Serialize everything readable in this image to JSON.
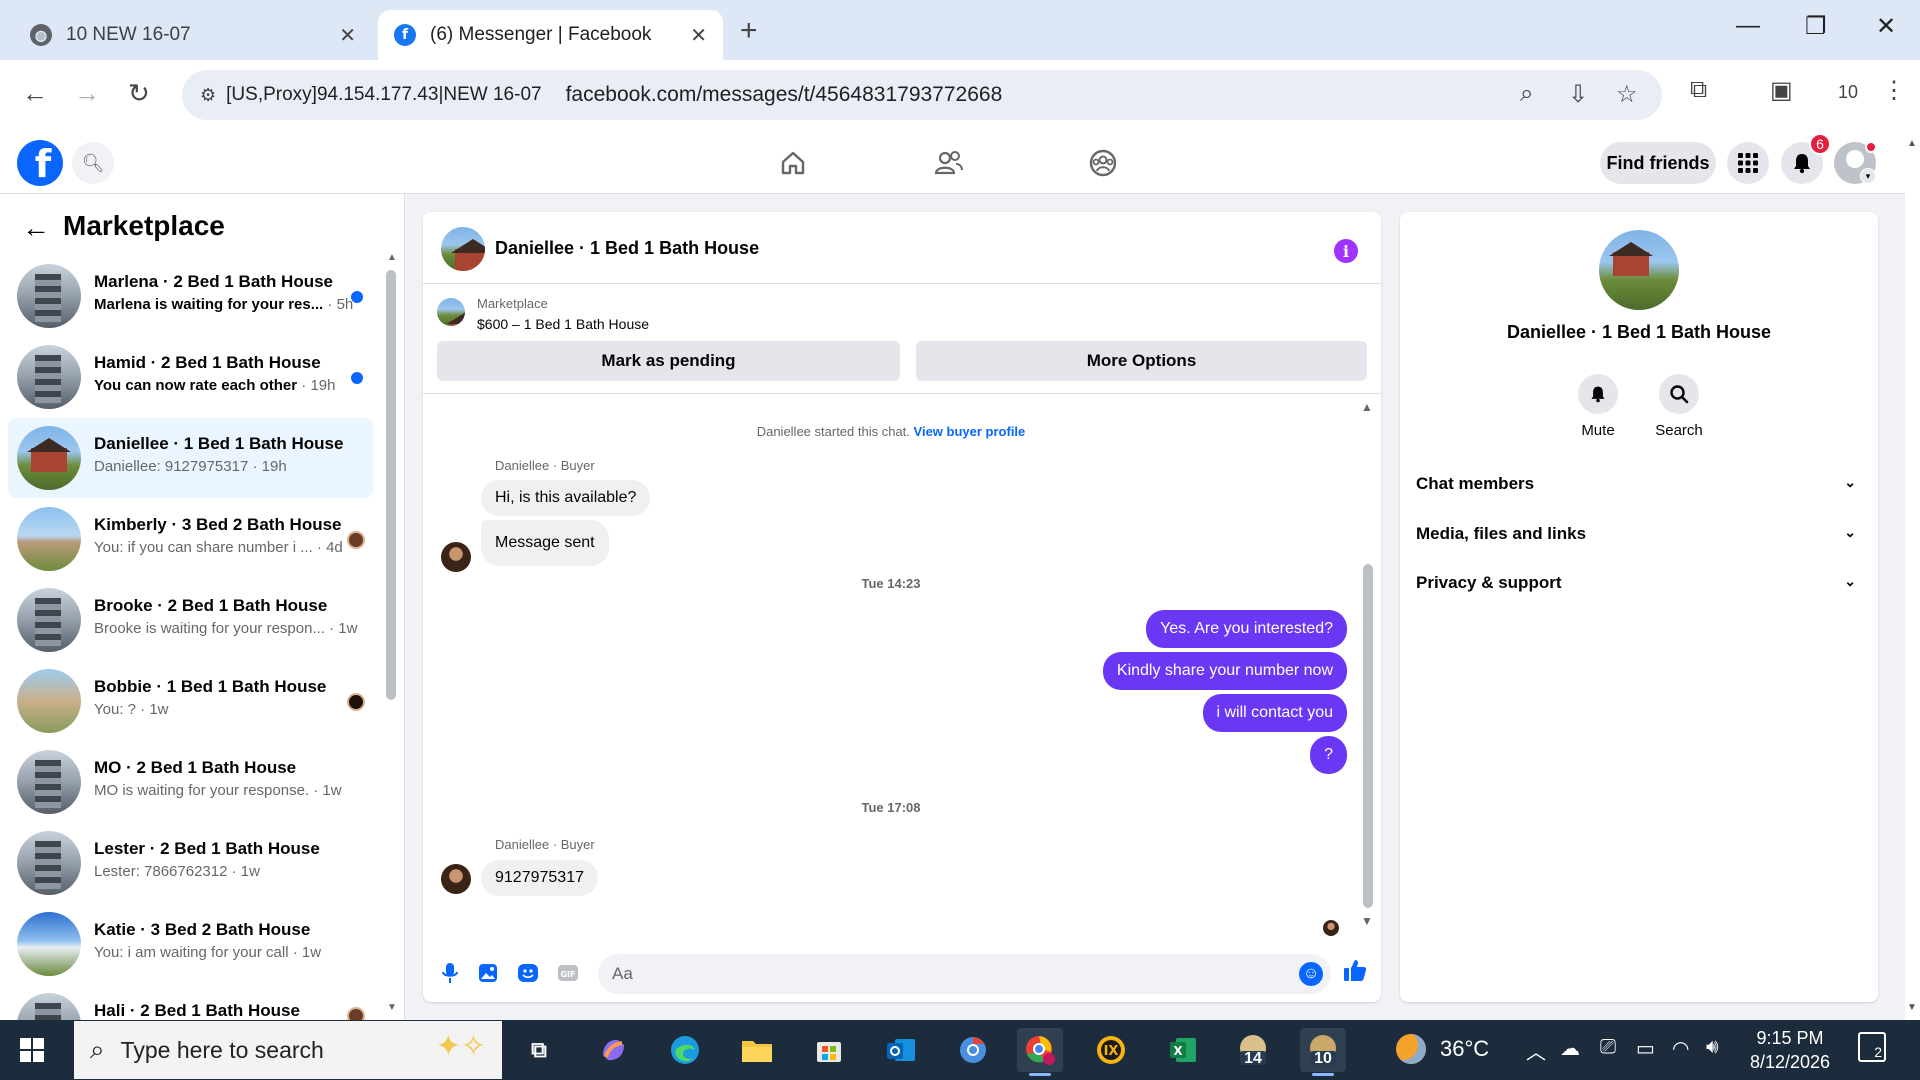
{
  "browser": {
    "tabs": [
      {
        "title": "10 NEW 16-07",
        "icon": "globe-icon",
        "active": false
      },
      {
        "title": "(6) Messenger | Facebook",
        "icon": "facebook-icon",
        "active": true
      }
    ],
    "proxy_chip": "[US,Proxy]94.154.177.43|NEW 16-07",
    "url": "facebook.com/messages/t/4564831793772668",
    "profile_count": "10"
  },
  "fb_header": {
    "find_friends_label": "Find friends",
    "notification_count": "6"
  },
  "left": {
    "back_icon": "arrow-left-icon",
    "title": "Marketplace",
    "conversations": [
      {
        "name": "Marlena · 2 Bed 1 Bath House",
        "preview": "Marlena is waiting for your res...",
        "time": "· 5h",
        "unread": true,
        "avatar": "apartment"
      },
      {
        "name": "Hamid · 2 Bed 1 Bath House",
        "preview": "You can now rate each other",
        "time": "· 19h",
        "unread": true,
        "avatar": "apartment"
      },
      {
        "name": "Daniellee · 1 Bed 1 Bath House",
        "preview": "Daniellee: 9127975317",
        "time": "· 19h",
        "unread": false,
        "active": true,
        "avatar": "house"
      },
      {
        "name": "Kimberly · 3 Bed 2 Bath House",
        "preview": "You: if you can share number i ...",
        "time": "· 4d",
        "unread": false,
        "avatar": "ranch"
      },
      {
        "name": "Brooke · 2 Bed 1 Bath House",
        "preview": "Brooke is waiting for your respon...",
        "time": "· 1w",
        "unread": false,
        "avatar": "apartment"
      },
      {
        "name": "Bobbie · 1 Bed 1 Bath House",
        "preview": "You: ?",
        "time": "· 1w",
        "unread": false,
        "avatar": "tan"
      },
      {
        "name": "MO · 2 Bed 1 Bath House",
        "preview": "MO is waiting for your response.",
        "time": "· 1w",
        "unread": false,
        "avatar": "apartment"
      },
      {
        "name": "Lester · 2 Bed 1 Bath House",
        "preview": "Lester: 7866762312",
        "time": "· 1w",
        "unread": false,
        "avatar": "apartment"
      },
      {
        "name": "Katie · 3 Bed 2 Bath House",
        "preview": "You: i am waiting for your call",
        "time": "· 1w",
        "unread": false,
        "avatar": "mobile"
      },
      {
        "name": "Hali · 2 Bed 1 Bath House",
        "preview": "",
        "time": "",
        "unread": false,
        "avatar": "apartment"
      }
    ]
  },
  "chat": {
    "title": "Daniellee · 1 Bed 1 Bath House",
    "listing_source": "Marketplace",
    "listing_price_title": "$600 – 1 Bed 1 Bath House",
    "mark_pending_label": "Mark as pending",
    "more_options_label": "More Options",
    "started_text": "Daniellee started this chat.",
    "view_buyer_profile": "View buyer profile",
    "sender_label": "Daniellee · Buyer",
    "msg_in_1": "Hi, is this available?",
    "msg_in_2": "Message sent",
    "time_1": "Tue 14:23",
    "msg_out_1": "Yes. Are you interested?",
    "msg_out_2": "Kindly share your number now",
    "msg_out_3": "i will contact you",
    "msg_out_4": "?",
    "time_2": "Tue 17:08",
    "msg_in_3": "9127975317",
    "composer_placeholder": "Aa",
    "accent_color": "#6a38f5"
  },
  "right": {
    "name": "Daniellee · 1 Bed 1 Bath House",
    "mute_label": "Mute",
    "search_label": "Search",
    "sections": [
      "Chat members",
      "Media, files and links",
      "Privacy & support"
    ]
  },
  "taskbar": {
    "search_placeholder": "Type here to search",
    "weather": "36°C",
    "time": "9:15 PM",
    "date": "8/12/2026",
    "notification_count": "2",
    "badge_14": "14",
    "badge_10": "10"
  }
}
